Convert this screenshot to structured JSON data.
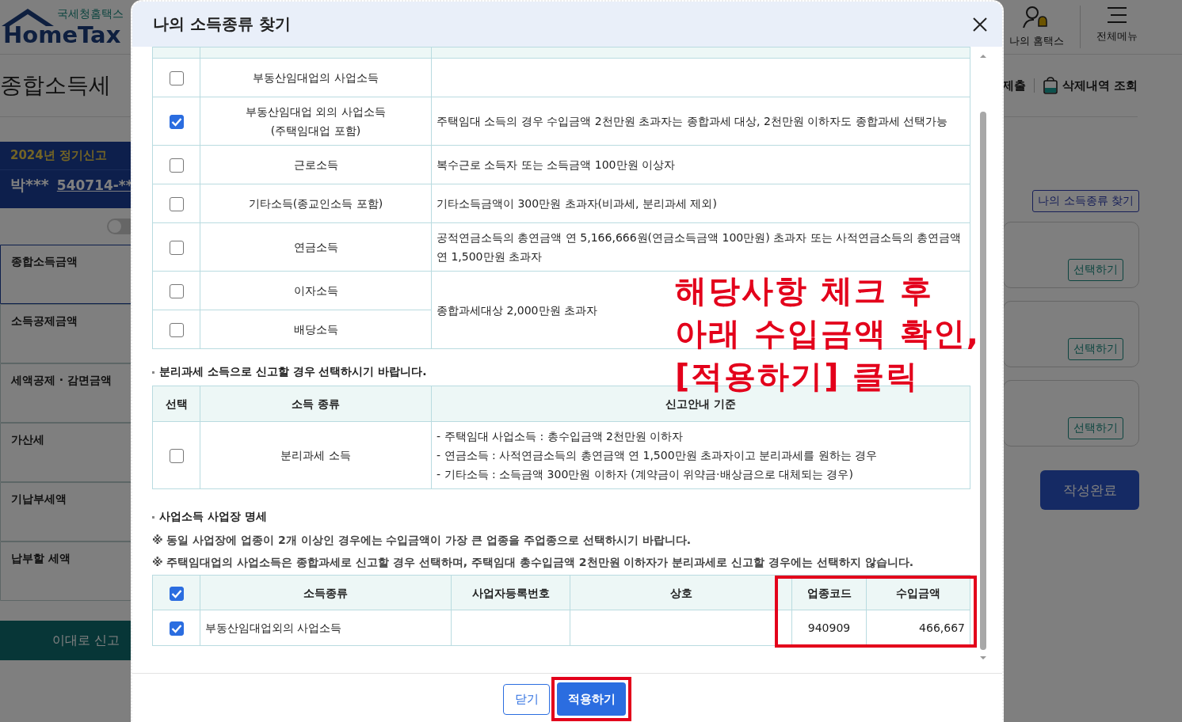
{
  "page": {
    "logo": {
      "tagline": "국세청홈택스",
      "name": "HomeTax"
    },
    "header_links": [
      {
        "label": "나의 홈택스",
        "kind": "user"
      },
      {
        "label": "전체메뉴",
        "kind": "menu"
      }
    ],
    "title": "종합소득세",
    "toolbar": [
      {
        "label": "제출",
        "kind": "submit"
      },
      {
        "label": "삭제내역 조회",
        "kind": "trash"
      }
    ],
    "filing": {
      "period": "2024년 정기신고",
      "name": "박***",
      "id": "540714-**"
    },
    "toggle": {
      "on": false
    },
    "sidebar": [
      {
        "label": "종합소득금액",
        "selected": true
      },
      {
        "label": "소득공제금액",
        "selected": false
      },
      {
        "label": "세액공제 · 감면금액",
        "selected": false
      },
      {
        "label": "가산세",
        "selected": false
      },
      {
        "label": "기납부세액",
        "selected": false
      },
      {
        "label": "납부할 세액",
        "selected": false
      }
    ],
    "report_button": "이대로 신고",
    "find_button": "나의 소득종류 찾기",
    "select_buttons": [
      "선택하기",
      "선택하기",
      "선택하기"
    ],
    "complete_button": "작성완료"
  },
  "modal": {
    "title": "나의 소득종류 찾기",
    "income_groups": [
      {
        "rows": [
          {
            "name": "부동산임대업의 사업소득",
            "checked": false
          }
        ]
      },
      {
        "guide": "주택임대 소득의 경우 수입금액 2천만원 초과자는 종합과세 대상, 2천만원 이하자도 종합과세 선택가능",
        "rows": [
          {
            "name": "부동산임대업 외의 사업소득\n(주택임대업 포함)",
            "checked": true
          }
        ]
      },
      {
        "guide": "복수근로 소득자 또는 소득금액 100만원 이상자",
        "rows": [
          {
            "name": "근로소득",
            "checked": false
          }
        ]
      },
      {
        "guide": "기타소득금액이 300만원 초과자(비과세, 분리과세 제외)",
        "rows": [
          {
            "name": "기타소득(종교인소득 포함)",
            "checked": false
          }
        ]
      },
      {
        "guide": "공적연금소득의 총연금액 연 5,166,666원(연금소득금액 100만원) 초과자 또는 사적연금소득의 총연금액 연 1,500만원 초과자",
        "rows": [
          {
            "name": "연금소득",
            "checked": false
          }
        ]
      },
      {
        "guide": "종합과세대상 2,000만원 초과자",
        "rows": [
          {
            "name": "이자소득",
            "checked": false
          },
          {
            "name": "배당소득",
            "checked": false
          }
        ]
      }
    ],
    "separate_note": "분리과세 소득으로 신고할 경우 선택하시기 바랍니다.",
    "separate_table": {
      "columns": [
        "선택",
        "소득 종류",
        "신고안내 기준"
      ],
      "rows": [
        {
          "name": "분리과세 소득",
          "checked": false,
          "guide": [
            "- 주택임대 사업소득 : 총수입금액 2천만원 이하자",
            "- 연금소득 : 사적연금소득의 총연금액 연 1,500만원 초과자이고 분리과세를 원하는 경우",
            "- 기타소득 : 소득금액 300만원 이하자 (계약금이 위약금·배상금으로 대체되는 경우)"
          ]
        }
      ]
    },
    "business_title": "사업소득 사업장 명세",
    "business_notes": [
      "※ 동일 사업장에 업종이 2개 이상인 경우에는 수입금액이 가장 큰 업종을 주업종으로 선택하시기 바랍니다.",
      "※ 주택임대업의 사업소득은 종합과세로 신고할 경우 선택하며, 주택임대 총수입금액 2천만원 이하자가 분리과세로 신고할 경우에는 선택하지 않습니다."
    ],
    "business_table": {
      "all_checked": true,
      "columns": [
        "소득종류",
        "사업자등록번호",
        "상호",
        "업종코드",
        "수입금액"
      ],
      "rows": [
        {
          "checked": true,
          "income_type": "부동산임대업외의 사업소득",
          "industry_code": "940909",
          "revenue": "466,667"
        }
      ]
    },
    "annotation": [
      "해당사항 체크 후",
      "아래 수입금액 확인,",
      "[적용하기] 클릭"
    ],
    "buttons": {
      "close": "닫기",
      "apply": "적용하기"
    }
  }
}
